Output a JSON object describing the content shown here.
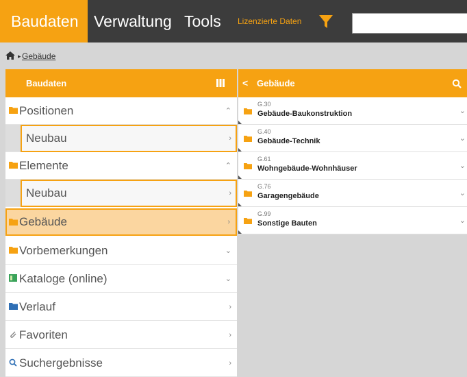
{
  "topnav": {
    "tabs": [
      "Baudaten",
      "Verwaltung",
      "Tools"
    ],
    "licensed_label": "Lizenzierte Daten",
    "search_value": ""
  },
  "breadcrumb": {
    "item": "Gebäude"
  },
  "left_panel": {
    "title": "Baudaten",
    "items": [
      {
        "label": "Positionen",
        "icon": "folder-icon",
        "icon_color": "#f6a212",
        "chevron": "⌃"
      },
      {
        "label": "Neubau",
        "chevron": "›"
      },
      {
        "label": "Elemente",
        "icon": "folder-icon",
        "icon_color": "#f6a212",
        "chevron": "⌃"
      },
      {
        "label": "Neubau",
        "chevron": "›"
      },
      {
        "label": "Gebäude",
        "icon": "folder-icon",
        "icon_color": "#f6a212",
        "chevron": "›"
      },
      {
        "label": "Vorbemerkungen",
        "icon": "folder-icon",
        "icon_color": "#f6a212",
        "chevron": "⌄"
      },
      {
        "label": "Kataloge (online)",
        "icon": "catalog-icon",
        "icon_color": "#3aa35a",
        "chevron": "⌄"
      },
      {
        "label": "Verlauf",
        "icon": "folder-icon",
        "icon_color": "#2f6fb5",
        "chevron": "›"
      },
      {
        "label": "Favoriten",
        "icon": "paperclip-icon",
        "icon_color": "#888888",
        "chevron": "›"
      },
      {
        "label": "Suchergebnisse",
        "icon": "search-icon",
        "icon_color": "#2f6fb5",
        "chevron": "›"
      }
    ]
  },
  "right_panel": {
    "back_label": "Gebäude",
    "items": [
      {
        "code": "G.30",
        "name": "Gebäude-Baukonstruktion"
      },
      {
        "code": "G.40",
        "name": "Gebäude-Technik"
      },
      {
        "code": "G.61",
        "name": "Wohngebäude-Wohnhäuser"
      },
      {
        "code": "G.76",
        "name": "Garagengebäude"
      },
      {
        "code": "G.99",
        "name": "Sonstige Bauten"
      }
    ]
  },
  "colors": {
    "accent": "#f6a212",
    "topbar": "#3c3c3c"
  }
}
